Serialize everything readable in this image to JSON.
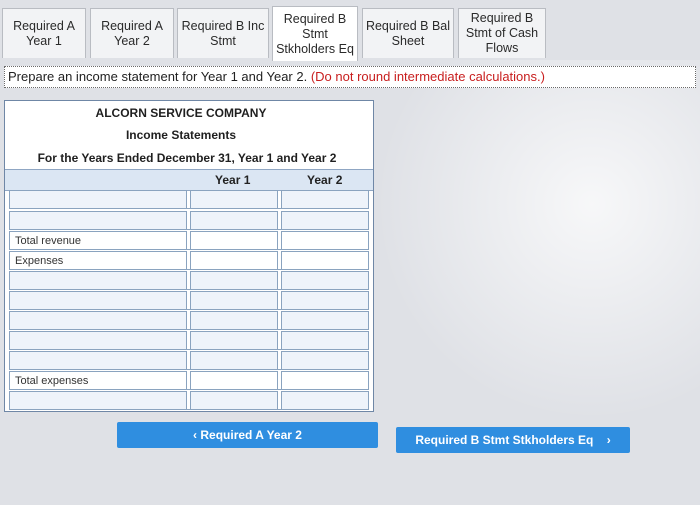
{
  "tabs": [
    {
      "label": "Required A\nYear 1"
    },
    {
      "label": "Required A\nYear 2"
    },
    {
      "label": "Required B Inc\nStmt"
    },
    {
      "label": "Required B\nStmt\nStkholders Eq"
    },
    {
      "label": "Required B Bal\nSheet"
    },
    {
      "label": "Required B\nStmt of Cash\nFlows"
    }
  ],
  "instruction": {
    "text": "Prepare an income statement for Year 1 and Year 2.",
    "note": "(Do not round intermediate calculations.)"
  },
  "statement": {
    "company": "ALCORN SERVICE COMPANY",
    "title": "Income Statements",
    "period": "For the Years Ended December 31, Year 1 and Year 2",
    "col_year1": "Year 1",
    "col_year2": "Year 2",
    "total_revenue_label": "Total revenue",
    "expenses_label": "Expenses",
    "total_expenses_label": "Total expenses"
  },
  "nav": {
    "prev_label": "Required A Year 2",
    "next_label": "Required B Stmt Stkholders Eq"
  },
  "colors": {
    "accent": "#2f8ee0",
    "instruction_note": "#c81e1e",
    "header_band": "#dbe6f3"
  }
}
